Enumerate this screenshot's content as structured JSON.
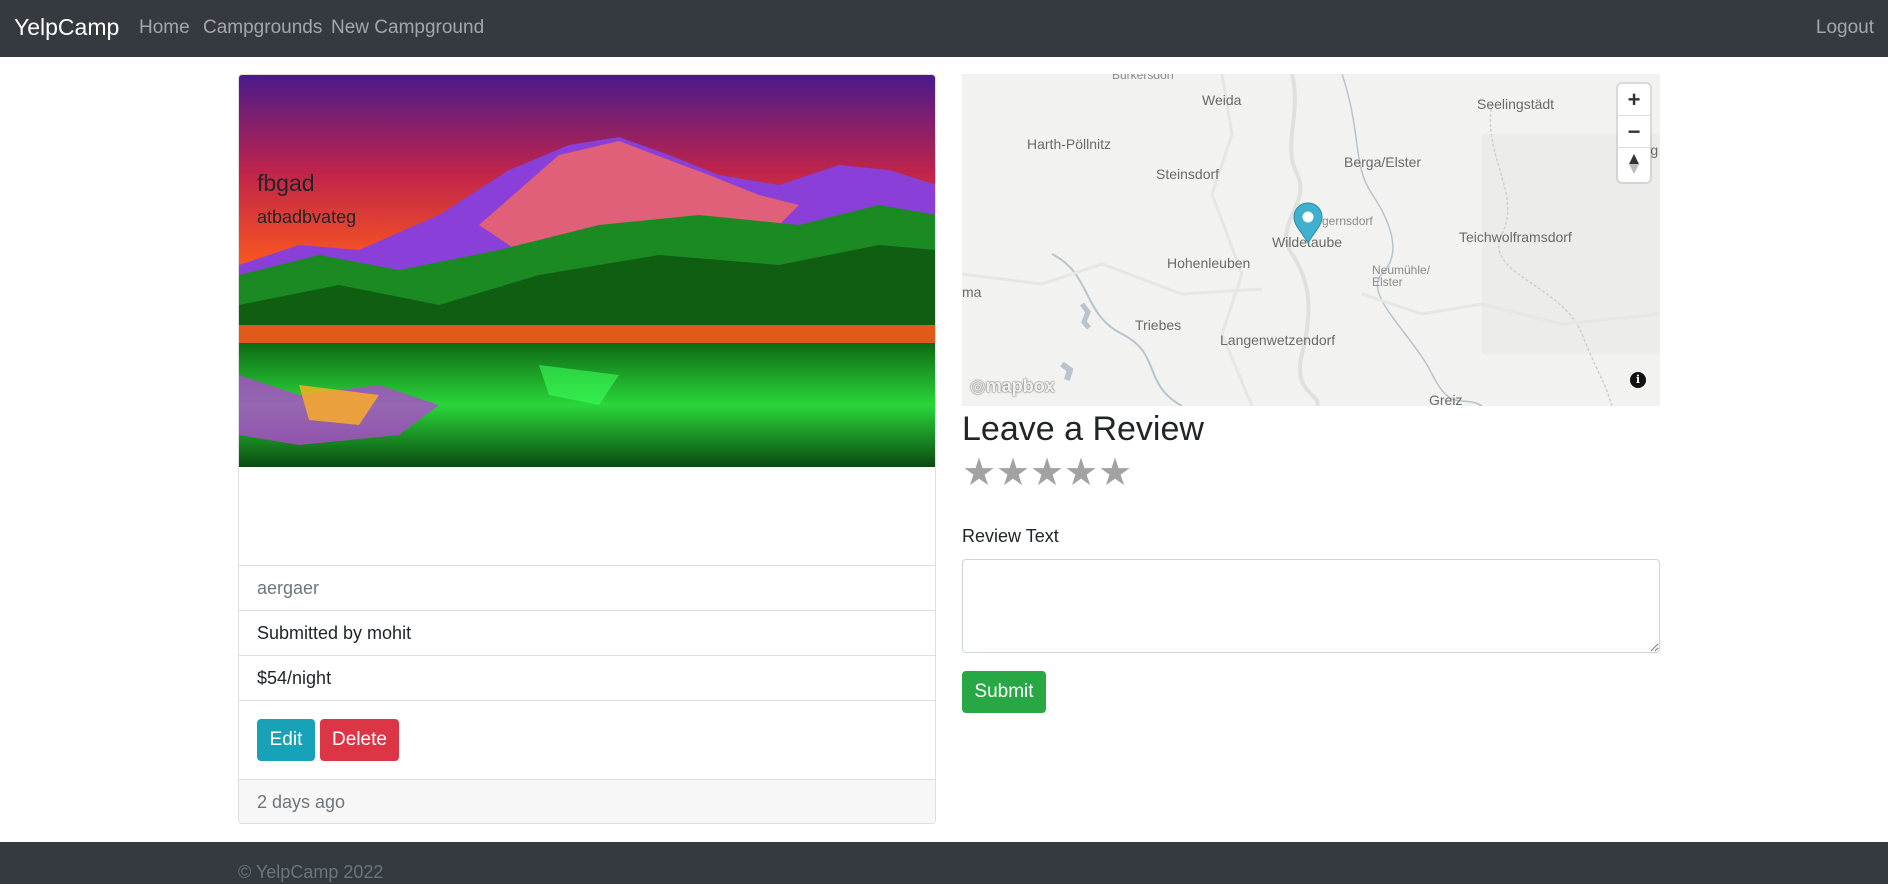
{
  "navbar": {
    "brand": "YelpCamp",
    "links": [
      "Home",
      "Campgrounds",
      "New Campground"
    ],
    "logout": "Logout"
  },
  "campground": {
    "title": "fbgad",
    "description": "atbadbvateg",
    "location": "aergaer",
    "author": "Submitted by mohit",
    "price": "$54/night",
    "edit_label": "Edit",
    "delete_label": "Delete",
    "posted": "2 days ago"
  },
  "map": {
    "labels": [
      "Weida",
      "Seelingstädt",
      "Harth-Pöllnitz",
      "Berga/Elster",
      "Steinsdorf",
      "Teichwolframsdorf",
      "Wildetaube",
      "Hohenleuben",
      "Neumühle/ Elster",
      "Triebes",
      "Langenwetzendorf",
      "Greiz",
      "ma",
      "Lang",
      "Burkersdorf",
      "gernsdorf"
    ],
    "zoom_in": "+",
    "zoom_out": "−",
    "attribution_logo": "mapbox",
    "info": "i"
  },
  "review": {
    "title": "Leave a Review",
    "rating": 0,
    "max_rating": 5,
    "text_label": "Review Text",
    "text_value": "",
    "submit_label": "Submit"
  },
  "footer": {
    "text": "© YelpCamp 2022"
  },
  "colors": {
    "navbar": "#343a40",
    "edit": "#17a2b8",
    "delete": "#dc3545",
    "submit": "#28a745",
    "marker": "#3fb1ce"
  }
}
